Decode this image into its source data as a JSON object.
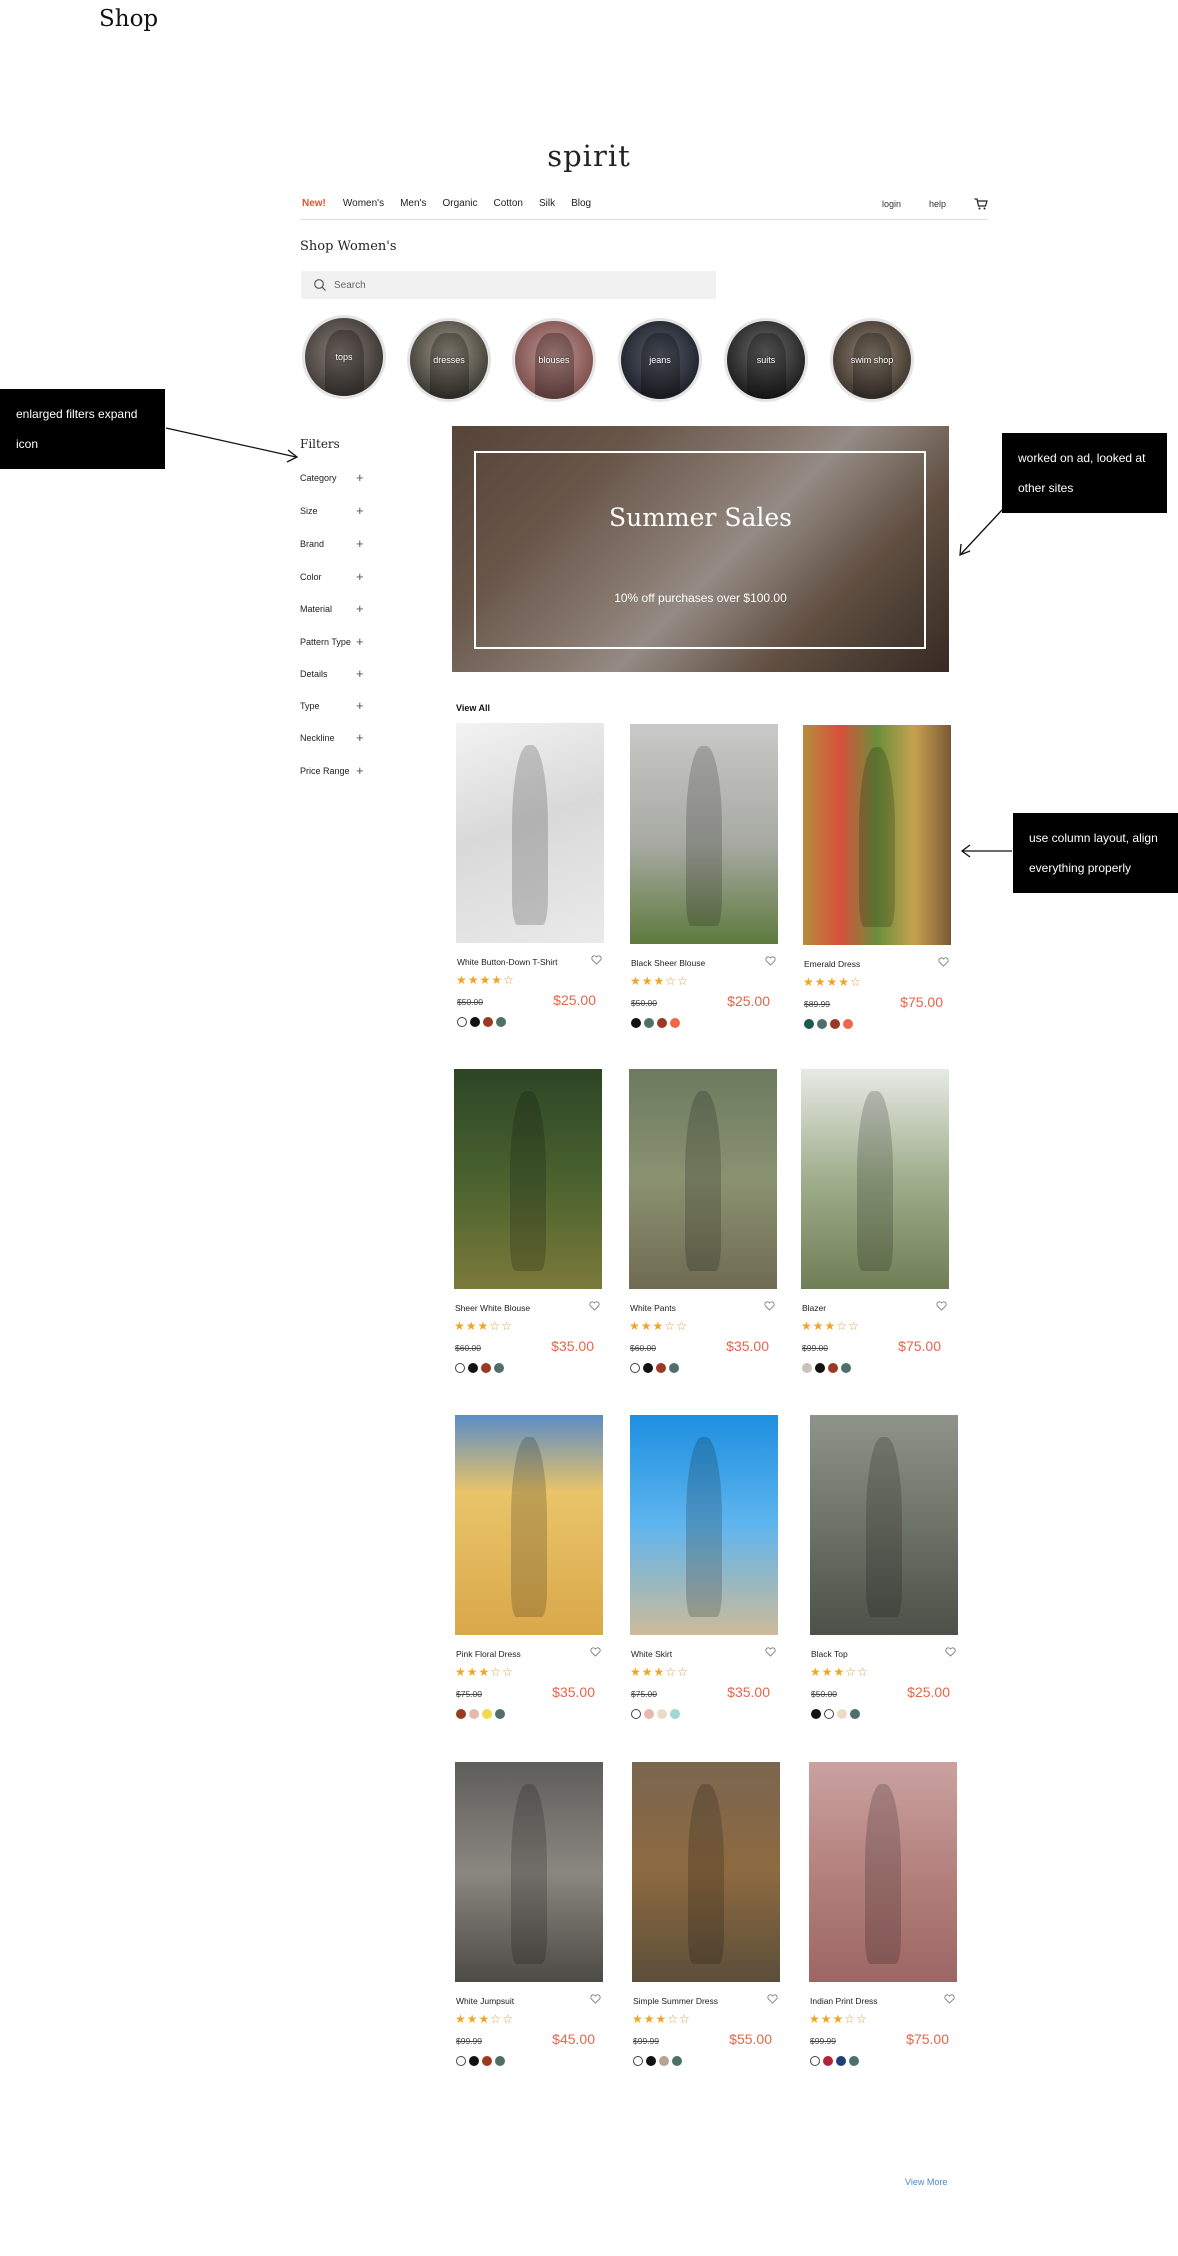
{
  "page": {
    "heading": "Shop"
  },
  "brand": {
    "logo": "spirit"
  },
  "nav": {
    "links": [
      "New!",
      "Women's",
      "Men's",
      "Organic",
      "Cotton",
      "Silk",
      "Blog"
    ],
    "login": "login",
    "help": "help",
    "cart_icon": "cart-icon"
  },
  "shop": {
    "title": "Shop Women's",
    "search": {
      "placeholder": "Search",
      "value": ""
    },
    "categories": [
      "tops",
      "dresses",
      "blouses",
      "jeans",
      "suits",
      "swim shop"
    ]
  },
  "filters": {
    "title": "Filters",
    "items": [
      "Category",
      "Size",
      "Brand",
      "Color",
      "Material",
      "Pattern Type",
      "Details",
      "Type",
      "Neckline",
      "Price Range"
    ]
  },
  "banner": {
    "title": "Summer Sales",
    "subtitle": "10% off purchases over $100.00"
  },
  "products_header": {
    "view_all": "View All"
  },
  "products": [
    {
      "name": "White Button-Down T-Shirt",
      "rating": 4,
      "old_price": "$50.00",
      "price": "$25.00",
      "swatches": [
        "#ffffff",
        "#111111",
        "#9a3a22",
        "#4e6f6a"
      ]
    },
    {
      "name": "Black Sheer Blouse",
      "rating": 3,
      "old_price": "$50.00",
      "price": "$25.00",
      "swatches": [
        "#111111",
        "#4e6f6a",
        "#9a3a22",
        "#f0684a"
      ]
    },
    {
      "name": "Emerald Dress",
      "rating": 4,
      "old_price": "$89.99",
      "price": "$75.00",
      "swatches": [
        "#1b5a50",
        "#4e6f6a",
        "#9a3a22",
        "#f0684a"
      ]
    },
    {
      "name": "Sheer White Blouse",
      "rating": 3,
      "old_price": "$60.00",
      "price": "$35.00",
      "swatches": [
        "#ffffff",
        "#111111",
        "#9a3a22",
        "#4e6f6a"
      ]
    },
    {
      "name": "White Pants",
      "rating": 3,
      "old_price": "$60.00",
      "price": "$35.00",
      "swatches": [
        "#ffffff",
        "#111111",
        "#9a3a22",
        "#4e6f6a"
      ]
    },
    {
      "name": "Blazer",
      "rating": 3,
      "old_price": "$99.00",
      "price": "$75.00",
      "swatches": [
        "#c8c2b8",
        "#111111",
        "#9a3a22",
        "#4e6f6a"
      ]
    },
    {
      "name": "Pink Floral Dress",
      "rating": 3,
      "old_price": "$75.00",
      "price": "$35.00",
      "swatches": [
        "#9a3a22",
        "#e6b9ae",
        "#f0d94a",
        "#4e6f6a"
      ]
    },
    {
      "name": "White Skirt",
      "rating": 3,
      "old_price": "$75.00",
      "price": "$35.00",
      "swatches": [
        "#ffffff",
        "#e6b9ae",
        "#eddcc4",
        "#9fd8cf"
      ]
    },
    {
      "name": "Black Top",
      "rating": 3,
      "old_price": "$50.00",
      "price": "$25.00",
      "swatches": [
        "#111111",
        "#ffffff",
        "#eddcc4",
        "#4e6f6a"
      ]
    },
    {
      "name": "White Jumpsuit",
      "rating": 3,
      "old_price": "$99.99",
      "price": "$45.00",
      "swatches": [
        "#ffffff",
        "#111111",
        "#9a3a22",
        "#4e6f6a"
      ]
    },
    {
      "name": "Simple Summer Dress",
      "rating": 3,
      "old_price": "$99.99",
      "price": "$55.00",
      "swatches": [
        "#ffffff",
        "#111111",
        "#b7a38f",
        "#4e6f6a"
      ]
    },
    {
      "name": "Indian Print Dress",
      "rating": 3,
      "old_price": "$99.99",
      "price": "$75.00",
      "swatches": [
        "#ffffff",
        "#b0243a",
        "#1f3f7a",
        "#4e6f6a"
      ]
    }
  ],
  "footer": {
    "view_more": "View More"
  },
  "annotations": {
    "filters_note": "enlarged filters expand icon",
    "ad_note": "worked on ad, looked at other sites",
    "layout_note": "use column layout, align everything properly"
  },
  "colors": {
    "accent": "#e8512f",
    "price": "#e8644a",
    "star": "#f0a623",
    "link": "#4a89c8"
  }
}
